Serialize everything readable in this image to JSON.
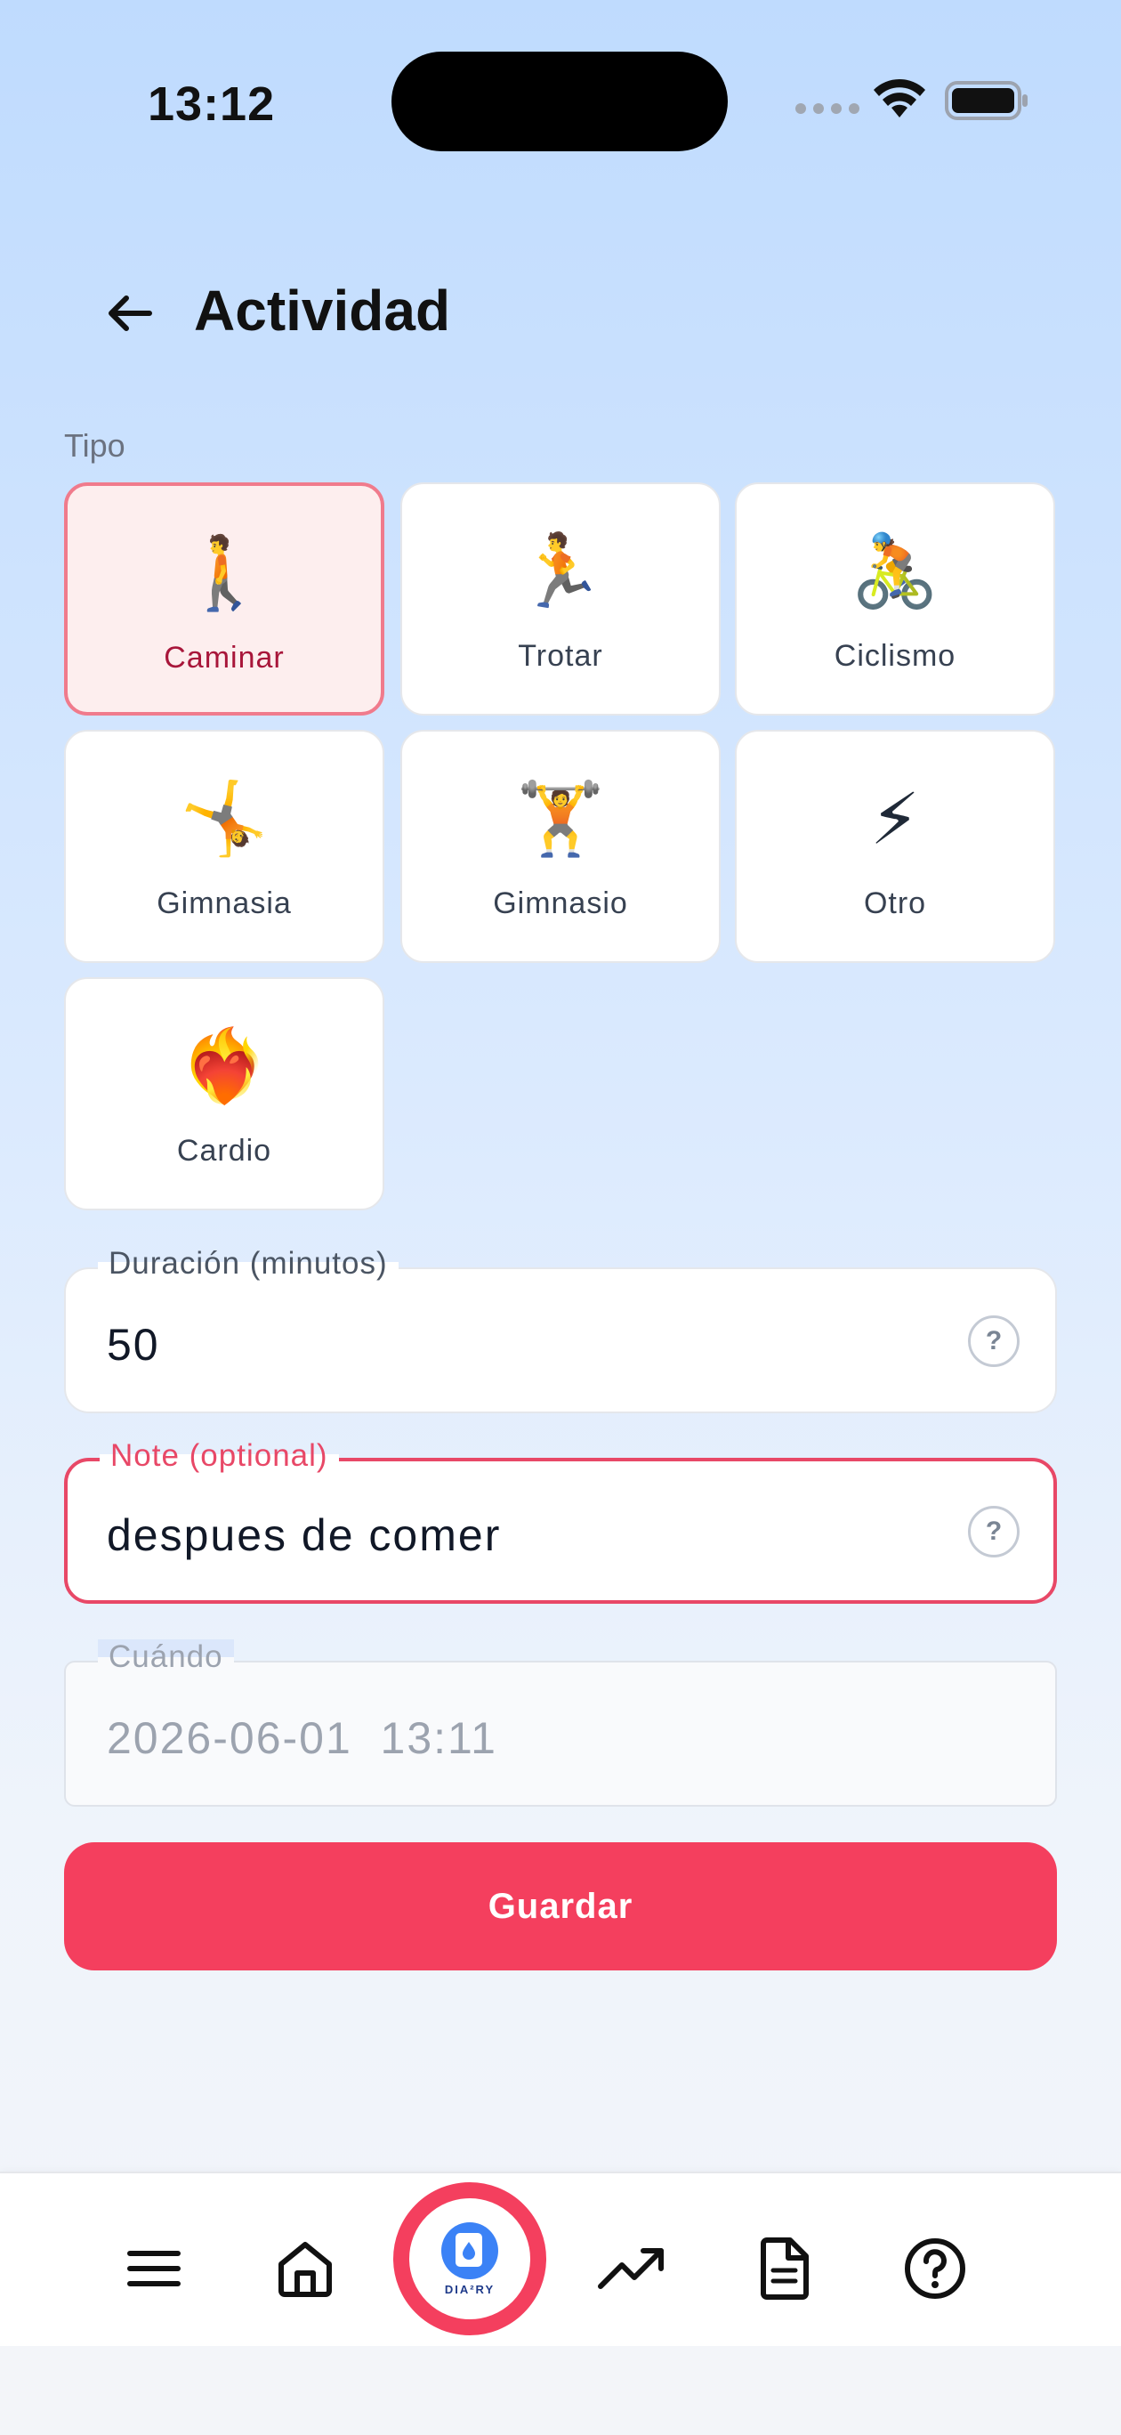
{
  "status_bar": {
    "time": "13:12"
  },
  "header": {
    "title": "Actividad"
  },
  "type_section": {
    "label": "Tipo",
    "options": [
      {
        "label": "Caminar",
        "emoji": "🚶",
        "selected": true
      },
      {
        "label": "Trotar",
        "emoji": "🏃",
        "selected": false
      },
      {
        "label": "Ciclismo",
        "emoji": "🚴",
        "selected": false
      },
      {
        "label": "Gimnasia",
        "emoji": "🤸",
        "selected": false
      },
      {
        "label": "Gimnasio",
        "emoji": "🏋️",
        "selected": false
      },
      {
        "label": "Otro",
        "emoji": "⚡",
        "selected": false
      },
      {
        "label": "Cardio",
        "emoji": "❤️‍🔥",
        "selected": false
      }
    ]
  },
  "duration_field": {
    "label": "Duración (minutos)",
    "value": "50"
  },
  "note_field": {
    "label": "Note (optional)",
    "value": "despues de comer"
  },
  "when_field": {
    "label": "Cuándo",
    "value": "2026-06-01  13:11"
  },
  "help_symbol": "?",
  "save_button": {
    "label": "Guardar"
  },
  "bottom_nav": {
    "items": [
      "menu-icon",
      "home-icon",
      "diary-logo",
      "trending-up-icon",
      "document-icon",
      "help-circle-icon"
    ],
    "center_logo_text": "DIA²RY"
  },
  "colors": {
    "accent": "#f43f5e",
    "selected_tile_bg": "#fdeeee",
    "selected_tile_border": "#f07b8c"
  }
}
